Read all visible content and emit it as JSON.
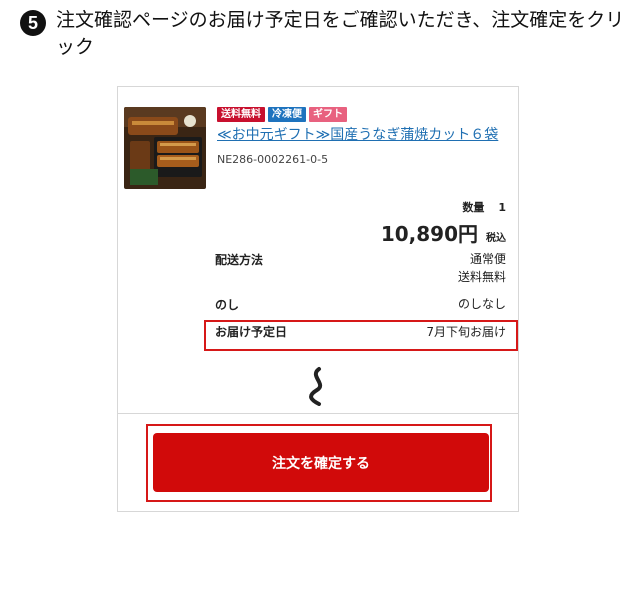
{
  "instruction": {
    "step_number": "5",
    "text": "注文確認ページのお届け予定日をご確認いただき、注文確定をクリック"
  },
  "product": {
    "badges": [
      "送料無料",
      "冷凍便",
      "ギフト"
    ],
    "name": "≪お中元ギフト≫国産うなぎ蒲焼カット６袋",
    "sku": "NE286-0002261-0-5",
    "quantity_label": "数量",
    "quantity": "1",
    "price": "10,890円",
    "tax_label": "税込"
  },
  "details": {
    "shipping_label": "配送方法",
    "shipping_value_1": "通常便",
    "shipping_value_2": "送料無料",
    "noshi_label": "のし",
    "noshi_value": "のしなし",
    "delivery_label": "お届け予定日",
    "delivery_value": "7月下旬お届け"
  },
  "actions": {
    "confirm_label": "注文を確定する"
  },
  "colors": {
    "accent_red": "#d10a0a",
    "highlight_red": "#d61818",
    "link_blue": "#1f6fb2",
    "badge_cold_blue": "#1e73be",
    "badge_gift_pink": "#e8617f"
  }
}
